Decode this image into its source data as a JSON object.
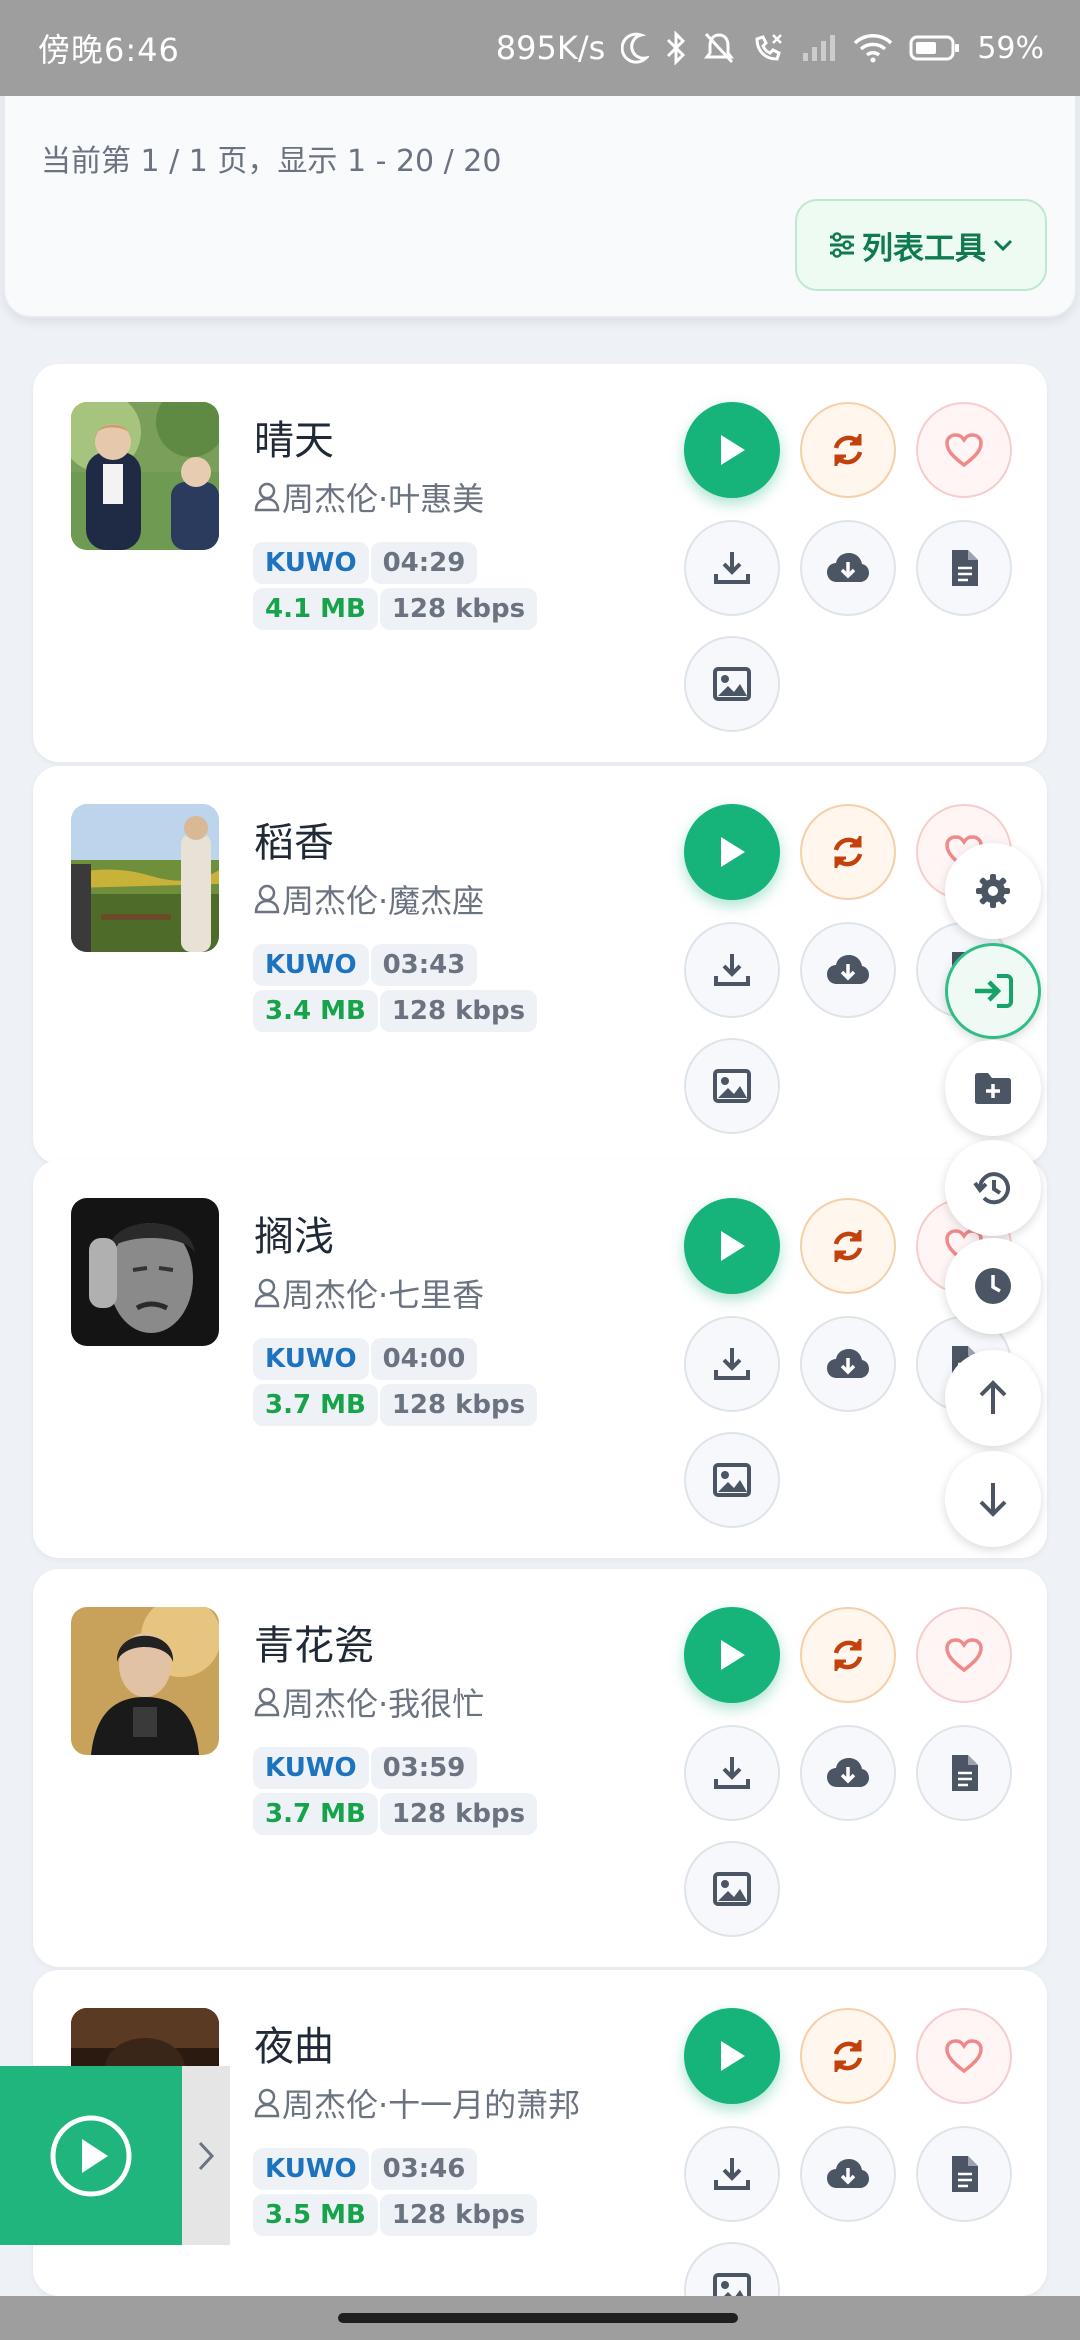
{
  "status_bar": {
    "time": "傍晚6:46",
    "speed": "895K/s",
    "battery": "59%"
  },
  "header": {
    "page_info": "当前第 1 / 1 页，显示 1 - 20 / 20",
    "tools_label": "列表工具"
  },
  "songs": [
    {
      "title": "晴天",
      "artist": "周杰伦·叶惠美",
      "source": "KUWO",
      "duration": "04:29",
      "size": "4.1 MB",
      "bitrate": "128 kbps"
    },
    {
      "title": "稻香",
      "artist": "周杰伦·魔杰座",
      "source": "KUWO",
      "duration": "03:43",
      "size": "3.4 MB",
      "bitrate": "128 kbps"
    },
    {
      "title": "搁浅",
      "artist": "周杰伦·七里香",
      "source": "KUWO",
      "duration": "04:00",
      "size": "3.7 MB",
      "bitrate": "128 kbps"
    },
    {
      "title": "青花瓷",
      "artist": "周杰伦·我很忙",
      "source": "KUWO",
      "duration": "03:59",
      "size": "3.7 MB",
      "bitrate": "128 kbps"
    },
    {
      "title": "夜曲",
      "artist": "周杰伦·十一月的萧邦",
      "source": "KUWO",
      "duration": "03:46",
      "size": "3.5 MB",
      "bitrate": "128 kbps"
    }
  ],
  "colors": {
    "accent": "#16b37a",
    "source_tag": "#1e73be",
    "size_tag": "#16a34a"
  },
  "icons": {
    "song_actions": [
      "play-icon",
      "refresh-icon",
      "heart-icon",
      "download-icon",
      "cloud-download-icon",
      "file-icon",
      "image-icon"
    ],
    "floating_menu": [
      "gear-icon",
      "login-icon",
      "folder-plus-icon",
      "history-icon",
      "clock-icon",
      "arrow-up-icon",
      "arrow-down-icon"
    ]
  }
}
